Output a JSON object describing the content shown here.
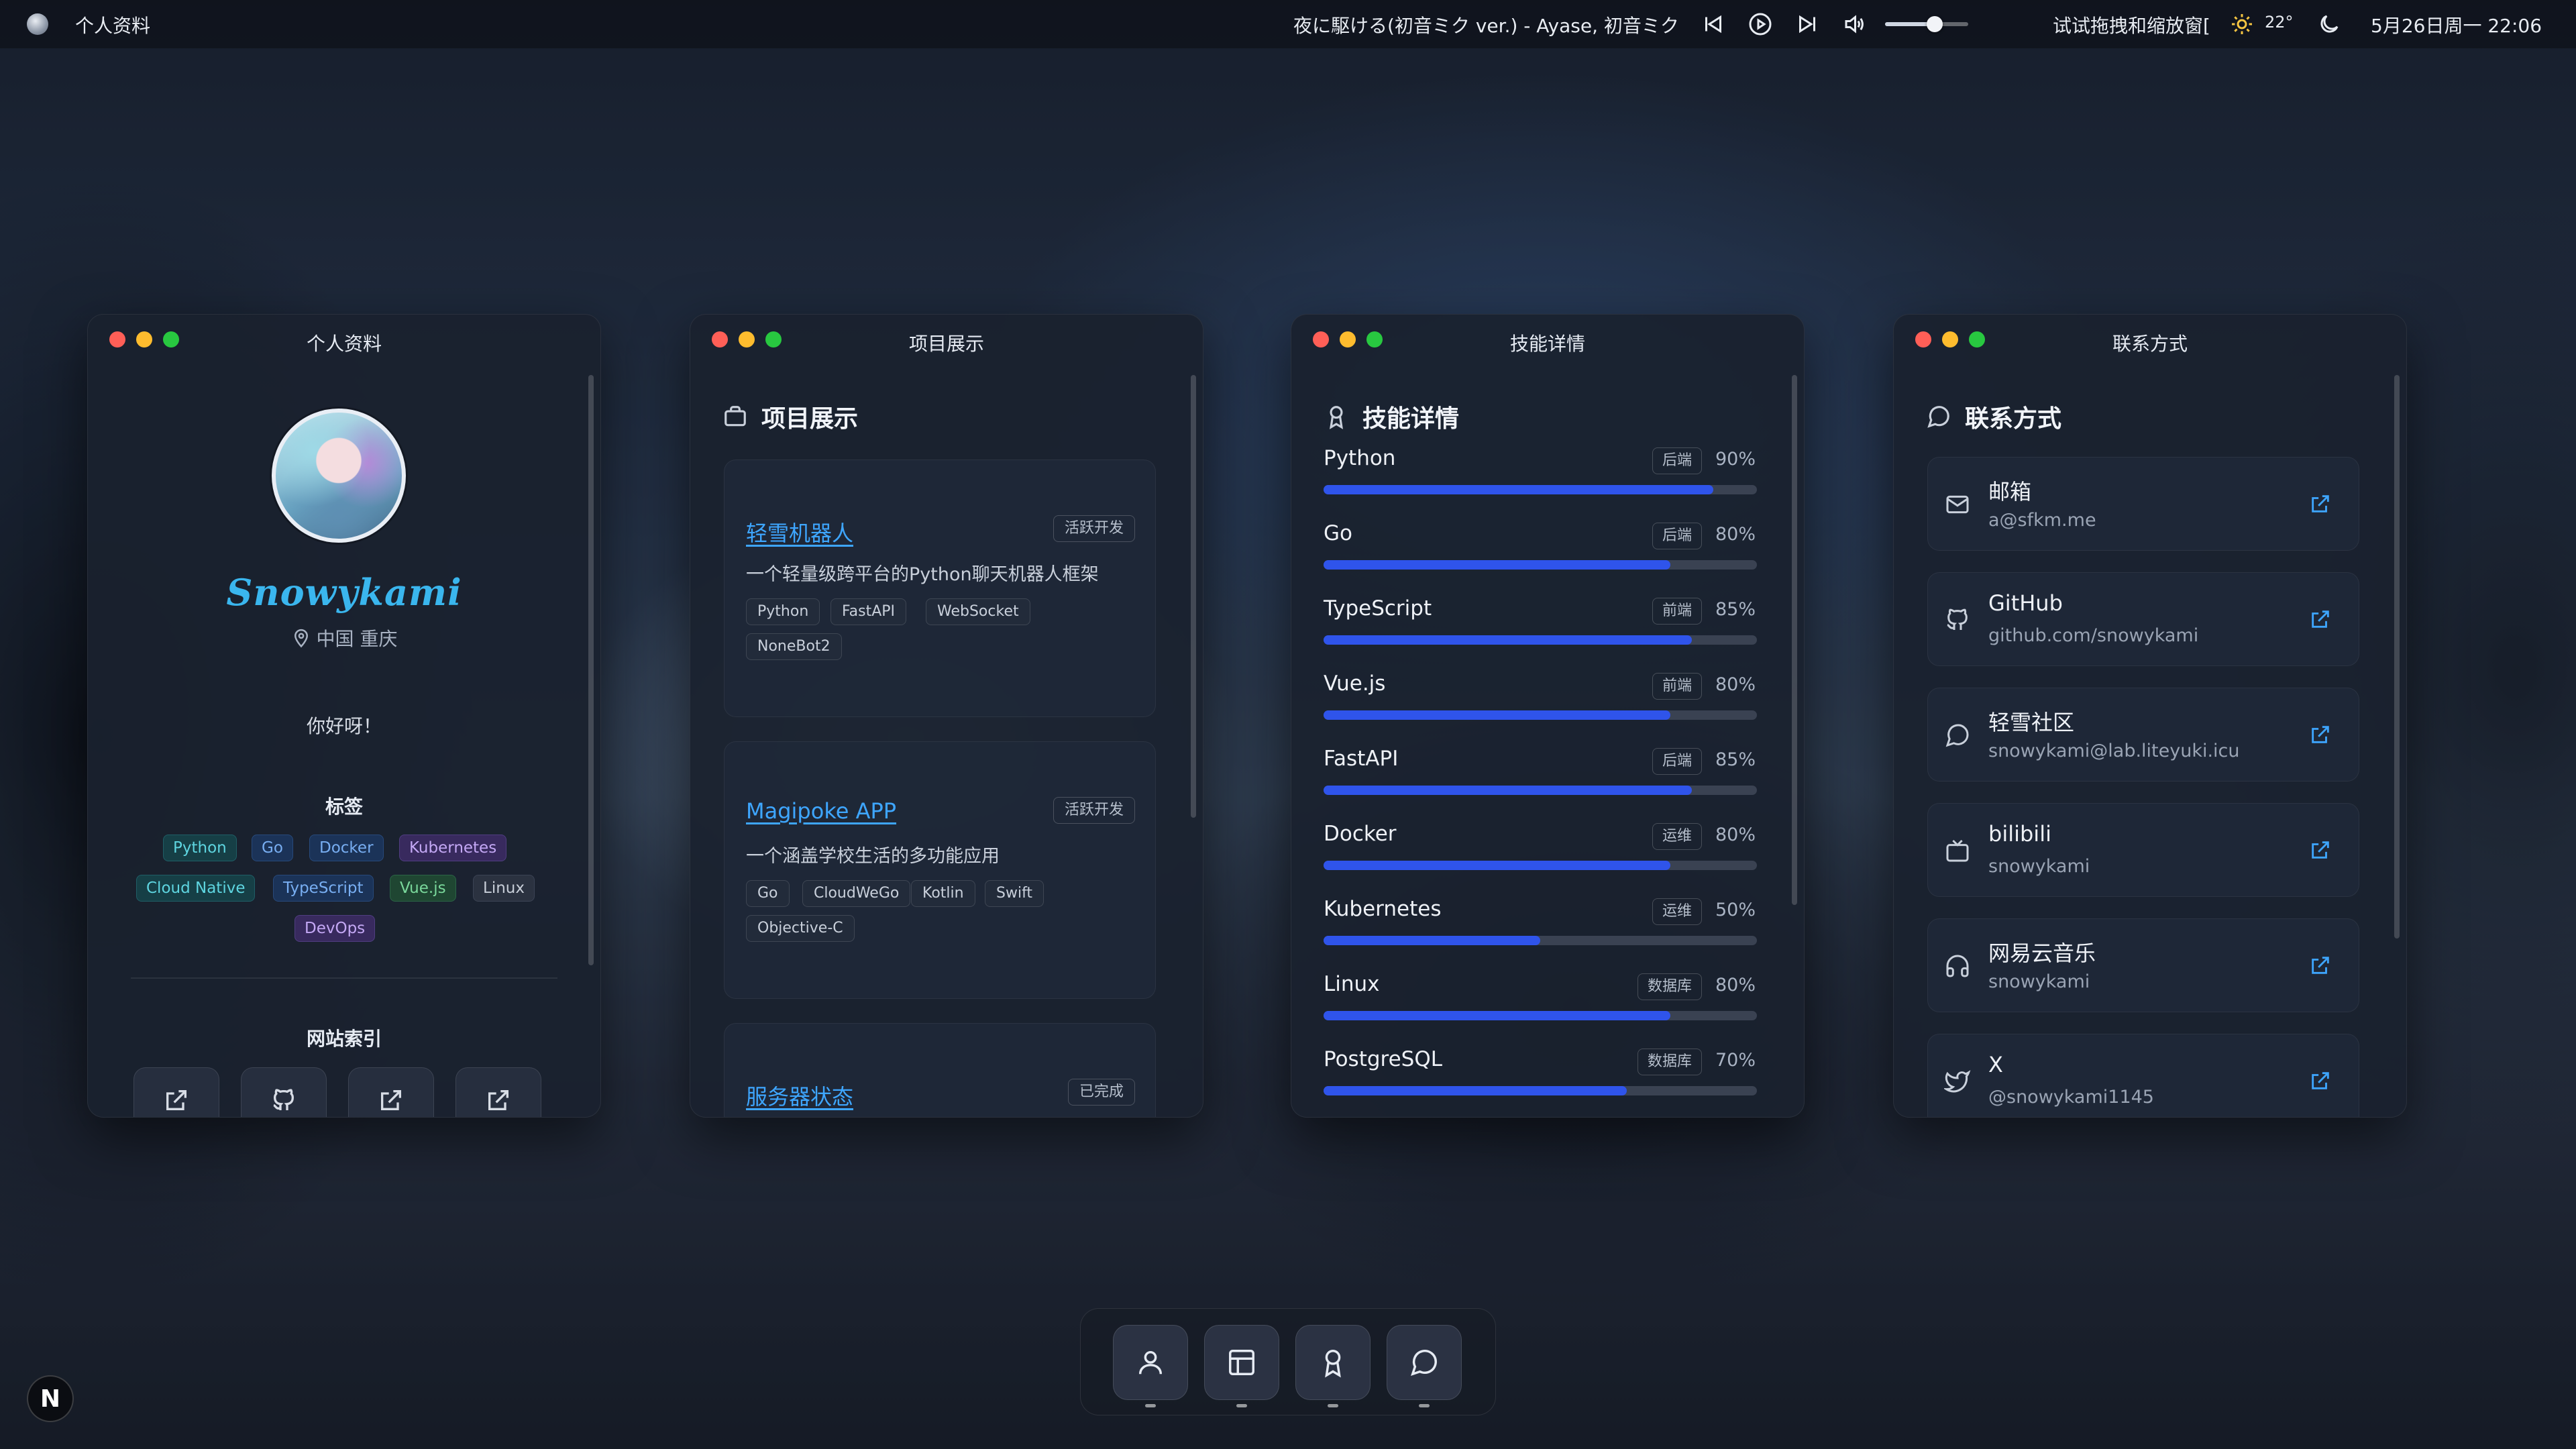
{
  "menubar": {
    "app_title": "个人资料",
    "now_playing": "夜に駆ける(初音ミク ver.) - Ayase, 初音ミク",
    "volume_level": 0.6,
    "marquee": "试试拖拽和缩放窗[",
    "temperature": "22°",
    "datetime": "5月26日周一  22:06"
  },
  "profile": {
    "window_title": "个人资料",
    "username": "Snowykami",
    "location": "中国 重庆",
    "greeting": "你好呀！",
    "tags_title": "标签",
    "tags": [
      "Python",
      "Go",
      "Docker",
      "Kubernetes",
      "Cloud Native",
      "TypeScript",
      "Vue.js",
      "Linux",
      "DevOps"
    ],
    "index_title": "网站索引"
  },
  "projects": {
    "window_title": "项目展示",
    "heading": "项目展示",
    "items": [
      {
        "name": "轻雪机器人",
        "status": "活跃开发",
        "description": "一个轻量级跨平台的Python聊天机器人框架",
        "tags": [
          "Python",
          "FastAPI",
          "WebSocket",
          "NoneBot2"
        ]
      },
      {
        "name": "Magipoke APP",
        "status": "活跃开发",
        "description": "一个涵盖学校生活的多功能应用",
        "tags": [
          "Go",
          "CloudWeGo",
          "Kotlin",
          "Swift",
          "Objective-C"
        ]
      },
      {
        "name": "服务器状态",
        "status": "已完成"
      }
    ]
  },
  "skills": {
    "window_title": "技能详情",
    "heading": "技能详情",
    "items": [
      {
        "name": "Python",
        "category": "后端",
        "percent": "90%",
        "level": 0.9
      },
      {
        "name": "Go",
        "category": "后端",
        "percent": "80%",
        "level": 0.8
      },
      {
        "name": "TypeScript",
        "category": "前端",
        "percent": "85%",
        "level": 0.85
      },
      {
        "name": "Vue.js",
        "category": "前端",
        "percent": "80%",
        "level": 0.8
      },
      {
        "name": "FastAPI",
        "category": "后端",
        "percent": "85%",
        "level": 0.85
      },
      {
        "name": "Docker",
        "category": "运维",
        "percent": "80%",
        "level": 0.8
      },
      {
        "name": "Kubernetes",
        "category": "运维",
        "percent": "50%",
        "level": 0.5
      },
      {
        "name": "Linux",
        "category": "数据库",
        "percent": "80%",
        "level": 0.8
      },
      {
        "name": "PostgreSQL",
        "category": "数据库",
        "percent": "70%",
        "level": 0.7
      }
    ]
  },
  "contacts": {
    "window_title": "联系方式",
    "heading": "联系方式",
    "items": [
      {
        "title": "邮箱",
        "value": "a@sfkm.me",
        "icon": "mail-icon"
      },
      {
        "title": "GitHub",
        "value": "github.com/snowykami",
        "icon": "github-icon"
      },
      {
        "title": "轻雪社区",
        "value": "snowykami@lab.liteyuki.icu",
        "icon": "chat-icon"
      },
      {
        "title": "bilibili",
        "value": "snowykami",
        "icon": "tv-icon"
      },
      {
        "title": "网易云音乐",
        "value": "snowykami",
        "icon": "headphones-icon"
      },
      {
        "title": "X",
        "value": "@snowykami1145",
        "icon": "twitter-icon"
      }
    ]
  },
  "dock": {
    "items": [
      "user-icon",
      "layout-icon",
      "award-icon",
      "chat-icon"
    ]
  },
  "badge": {
    "label": "N"
  },
  "colors": {
    "accent_blue": "#2f54eb",
    "link_blue": "#3ea6ff",
    "username_cyan": "#3ab6ee",
    "traffic_red": "#ff5f57",
    "traffic_yellow": "#febc2e",
    "traffic_green": "#28c840"
  }
}
